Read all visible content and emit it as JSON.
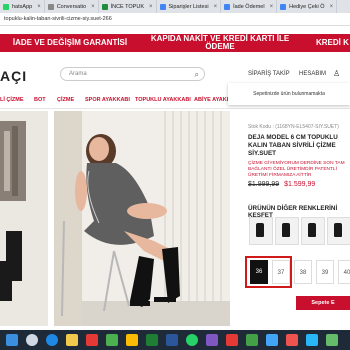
{
  "browser": {
    "tabs": [
      {
        "label": "hatsApp",
        "color": "#25d366"
      },
      {
        "label": "Conversatio",
        "color": "#888888"
      },
      {
        "label": "İNCE TOPUK",
        "color": "#1e8e3e"
      },
      {
        "label": "Siparişler Listesi",
        "color": "#4285f4"
      },
      {
        "label": "İade Ödemel",
        "color": "#4285f4"
      },
      {
        "label": "Hediye Çeki Ö",
        "color": "#4285f4"
      }
    ],
    "url": "topuklu-kalin-taban-sivrili-cizme-siy.suet-266"
  },
  "promo": {
    "left": "İADE VE DEĞİŞİM GARANTİSİ",
    "center": "KAPIDA NAKİT VE KREDİ KARTI İLE ÖDEME",
    "right": "KREDİ K"
  },
  "header": {
    "logo": "AÇI",
    "search_placeholder": "Arama",
    "order_track": "SİPARİŞ TAKİP",
    "account": "HESABIM"
  },
  "popup": {
    "text": "Sepetinizde ürün bulunmamakta"
  },
  "nav": [
    "Lİ ÇİZME",
    "BOT",
    "ÇİZME",
    "SPOR AYAKKABI",
    "TOPUKLU AYAKKABI",
    "ABİYE AYAKKABI"
  ],
  "product": {
    "sku": "Stok Kodu : (1168YN-EL5407-SIY.SUET)",
    "name": "DEJA MODEL 6 CM TOPUKLU KALIN TABAN SİVRİLİ ÇİZME SİY.SUET",
    "desc": "ÇİZME GİYEMİYORUM DERDİNE SON TAM BAĞLANTI ÖZEL ÜRETİMDİR PATENTLİ ÜRETİMİ FİRMAMIZA AİTTİR",
    "old_price": "$1.999,99",
    "new_price": "$1.599,99",
    "colors_title": "ÜRÜNÜN DİĞER RENKLERİNİ KEŞFET",
    "sizes": [
      "36",
      "37",
      "38",
      "39",
      "40"
    ],
    "selected_size": "36",
    "add_to_cart": "Sepete E"
  }
}
